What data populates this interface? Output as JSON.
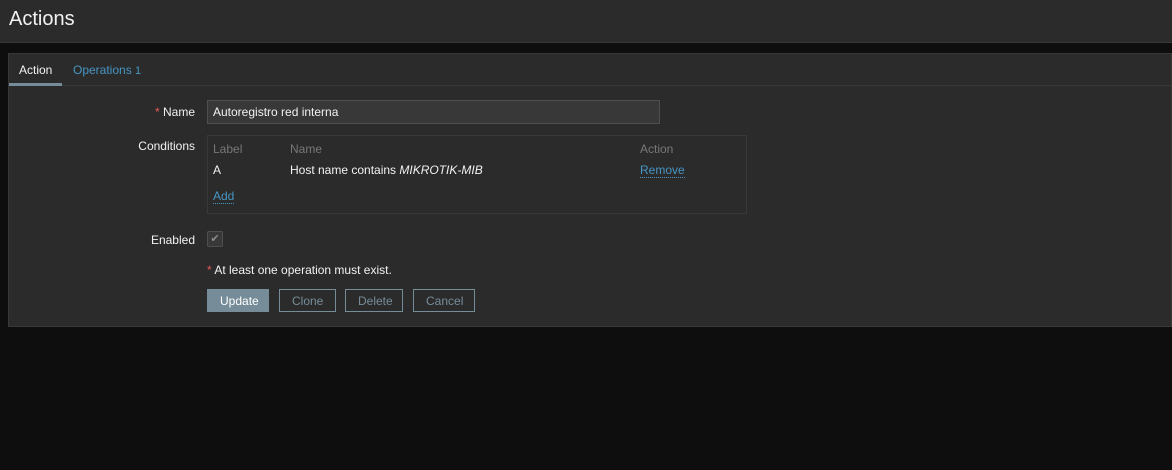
{
  "header": {
    "title": "Actions"
  },
  "tabs": [
    {
      "label": "Action"
    },
    {
      "label": "Operations",
      "count": "1"
    }
  ],
  "form": {
    "name_label": "Name",
    "name_value": "Autoregistro red interna",
    "conditions_label": "Conditions",
    "conditions": {
      "headers": [
        "Label",
        "Name",
        "Action"
      ],
      "rows": [
        {
          "label": "A",
          "text": "Host name contains ",
          "value": "MIKROTIK-MIB",
          "action": "Remove"
        }
      ],
      "add": "Add"
    },
    "enabled_label": "Enabled",
    "enabled": true,
    "warning": "At least one operation must exist.",
    "required_mark": "*"
  },
  "buttons": {
    "update": "Update",
    "clone": "Clone",
    "delete": "Delete",
    "cancel": "Cancel"
  }
}
